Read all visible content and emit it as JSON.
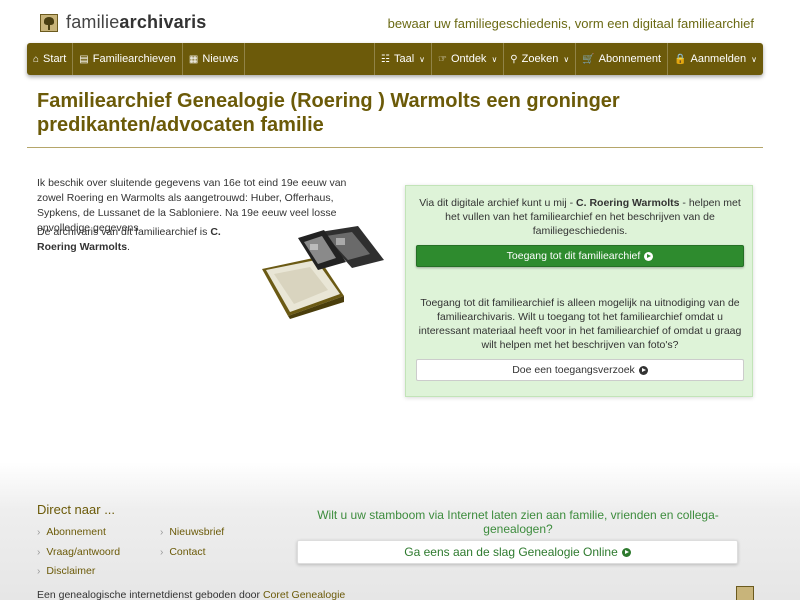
{
  "header": {
    "logo_plain": "familie",
    "logo_bold": "archivaris",
    "tagline": "bewaar uw familiegeschiedenis, vorm een digitaal familiearchief"
  },
  "nav": {
    "left": [
      {
        "label": "Start",
        "icon": "home-icon"
      },
      {
        "label": "Familiearchieven",
        "icon": "book-icon"
      },
      {
        "label": "Nieuws",
        "icon": "newspaper-icon"
      }
    ],
    "right": [
      {
        "label": "Taal",
        "icon": "language-icon"
      },
      {
        "label": "Ontdek",
        "icon": "pointer-icon"
      },
      {
        "label": "Zoeken",
        "icon": "search-icon"
      },
      {
        "label": "Abonnement",
        "icon": "cart-icon"
      },
      {
        "label": "Aanmelden",
        "icon": "lock-icon"
      }
    ]
  },
  "page": {
    "title": "Familiearchief Genealogie (Roering ) Warmolts een groninger predikanten/advocaten familie",
    "intro": "Ik beschik over sluitende gegevens van 16e tot eind 19e eeuw van zowel Roering en Warmolts als aangetrouwd: Huber, Offerhaus, Sypkens, de Lussanet de la Sabloniere. Na 19e eeuw veel losse onvolledige gegevens",
    "archivaris_prefix": "De archivaris van dit familiearchief is ",
    "archivaris_name": "C. Roering Warmolts",
    "archivaris_suffix": "."
  },
  "panel": {
    "text1_prefix": "Via dit digitale archief kunt u mij - ",
    "text1_name": "C. Roering Warmolts",
    "text1_suffix": " - helpen met het vullen van het familiearchief en het beschrijven van de familiegeschiedenis.",
    "access_button": "Toegang tot dit familiearchief",
    "text2": "Toegang tot dit familiearchief is alleen mogelijk na uitnodiging van de familiearchivaris. Wilt u toegang tot het familiearchief omdat u interessant materiaal heeft voor in het familiearchief of omdat u graag wilt helpen met het beschrijven van foto's?",
    "request_button": "Doe een toegangsverzoek"
  },
  "footer": {
    "title": "Direct naar ...",
    "links": [
      "Abonnement",
      "Nieuwsbrief",
      "Vraag/antwoord",
      "Contact",
      "Disclaimer"
    ],
    "promo": "Wilt u uw stamboom via Internet laten zien aan familie, vrienden en collega-genealogen?",
    "promo_button": "Ga eens aan de slag Genealogie Online",
    "bottom_prefix": "Een genealogische internetdienst geboden door ",
    "bottom_link": "Coret Genealogie"
  },
  "colors": {
    "nav_bg": "#6c5a0a",
    "title": "#6b5a08",
    "panel_bg": "#def3d8",
    "green_button": "#2e8b2e"
  }
}
